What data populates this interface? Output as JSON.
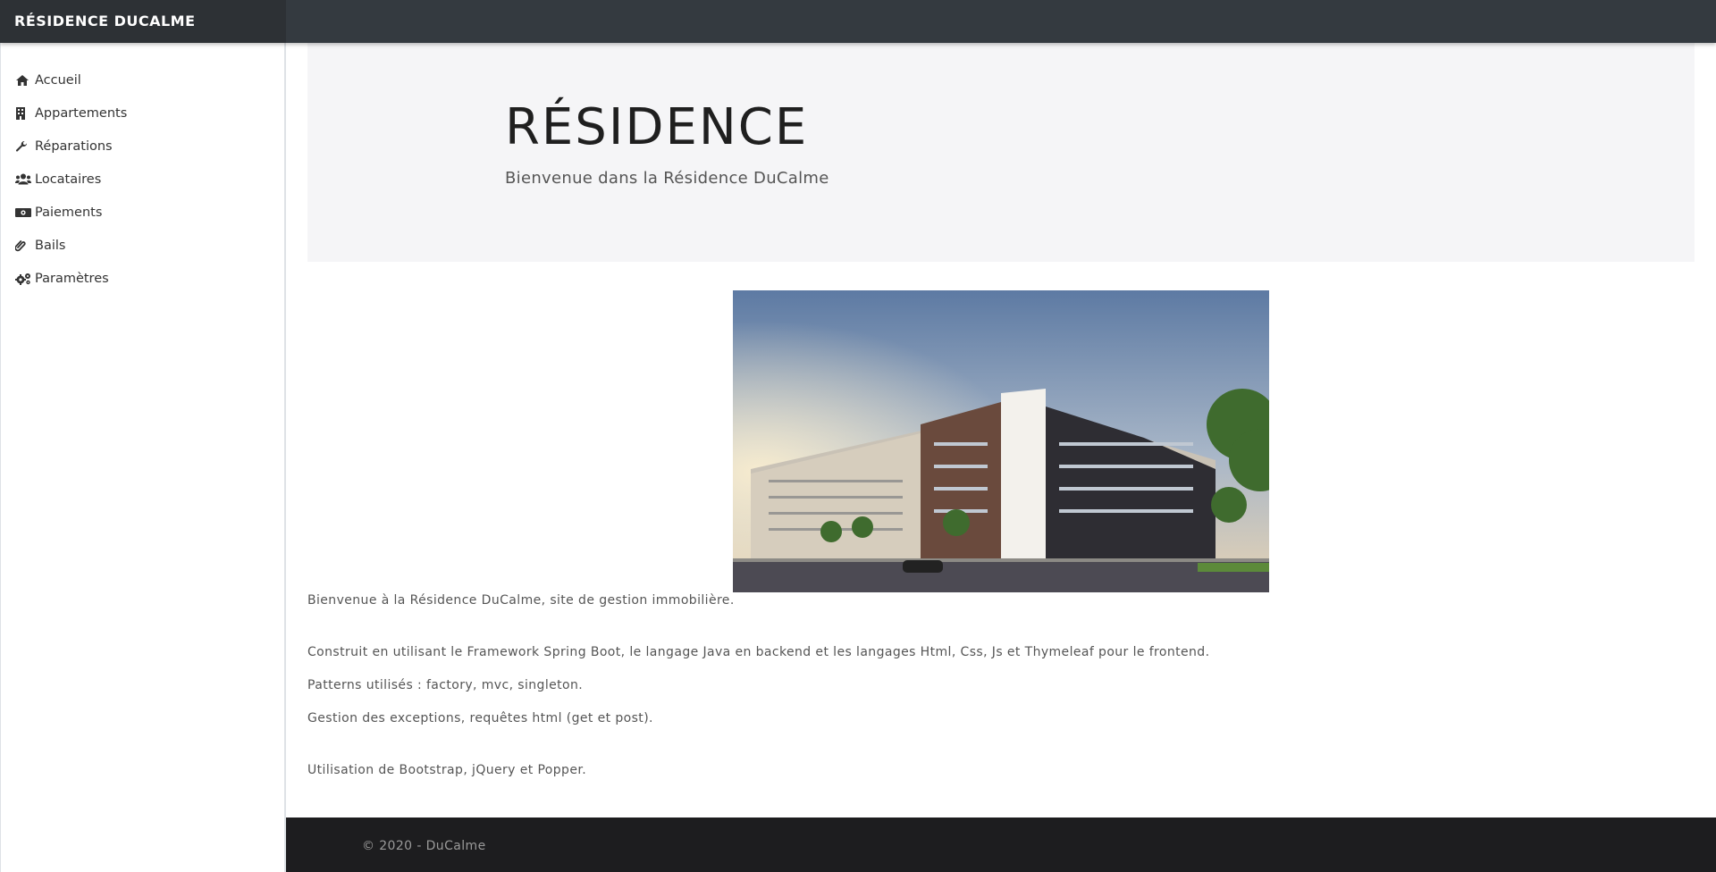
{
  "app": {
    "brand": "RÉSIDENCE DUCALME"
  },
  "sidebar": {
    "items": [
      {
        "label": "Accueil",
        "icon": "home-icon"
      },
      {
        "label": "Appartements",
        "icon": "building-icon"
      },
      {
        "label": "Réparations",
        "icon": "wrench-icon"
      },
      {
        "label": "Locataires",
        "icon": "users-icon"
      },
      {
        "label": "Paiements",
        "icon": "money-bill-icon"
      },
      {
        "label": "Bails",
        "icon": "paperclip-icon"
      },
      {
        "label": "Paramètres",
        "icon": "cogs-icon"
      }
    ]
  },
  "jumbotron": {
    "title": "RÉSIDENCE",
    "subtitle": "Bienvenue dans la Résidence DuCalme"
  },
  "content": {
    "image": "residential-building-photo",
    "paragraphs": [
      "Bienvenue à la Résidence DuCalme, site de gestion immobilière.",
      "Construit en utilisant le Framework Spring Boot, le langage Java en backend et les langages Html, Css, Js et Thymeleaf pour le frontend.",
      "Patterns utilisés : factory, mvc, singleton.",
      "Gestion des exceptions, requêtes html (get et post).",
      "Utilisation de Bootstrap, jQuery et Popper."
    ]
  },
  "footer": {
    "text": "© 2020 - DuCalme"
  },
  "colors": {
    "topbar": "#343a40",
    "jumbotron": "#f5f5f7",
    "footer": "#1d1d1f"
  }
}
